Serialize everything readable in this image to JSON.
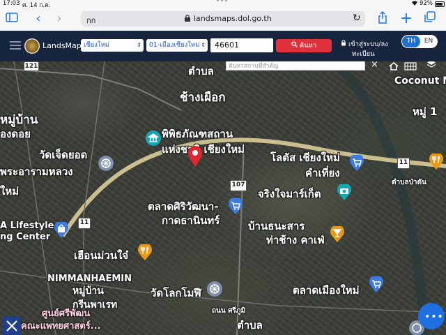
{
  "status_bar": {
    "time": "17:03",
    "date": "ศ. 14 ก.ค.",
    "battery": "92%"
  },
  "safari": {
    "tab_prefix": "กก",
    "url": "landsmaps.dol.go.th",
    "icons": [
      "sidebar-icon",
      "back-icon",
      "forward-icon",
      "reload-icon",
      "share-icon",
      "new-tab-icon",
      "tabs-icon"
    ]
  },
  "header": {
    "brand": "LandsMaps",
    "province": "เชียงใหม่",
    "district": "01-เมืองเชียงใหม่",
    "parcel_value": "46601",
    "search_label": "ค้นหา",
    "login_line1": "เข้าสู่ระบบ/ลง",
    "login_line2": "ทะเบียน",
    "lang_th": "TH",
    "lang_en": "EN"
  },
  "map": {
    "place_search_placeholder": "ค้นหาสถานที่สำคัญ",
    "labels": [
      "ตำบล",
      "ช้างเผือก",
      "หมู่บ้าน",
      "องดอย",
      "วัดเจ็ดยอด",
      "พระอารามหลวง",
      "พิพิธภัณฑสถาน",
      "แห่งชาติ เชียงใหม่",
      "โลตัส เชียงใหม่",
      "คำเที่ยง",
      "จริงใจมาร์เก็ต",
      "ตลาดศิริวัฒนา-",
      "กาดธานินทร์",
      "บ้านธนะสาร",
      "ท่าช้าง คาเฟ่",
      "เฮือนม่วนใจ๋",
      "NIMMANHAEMIN",
      "หมู่บ้าน",
      "กรีนพาเรท",
      "วัดโลกโมฬี",
      "ตลาดเมืองใหม่",
      "Coconut M",
      "หมู่ 1",
      "ใหม่",
      "A Lifestyle",
      "ng Center",
      "ศูนย์ศรีพัฒน",
      "คณะแพทยศาสตร์...",
      "ตำบล",
      "ตำบลป่าตัน",
      "ถนน ศรีภูมิ"
    ],
    "road_shields": [
      "121",
      "107",
      "11",
      "11"
    ]
  }
}
